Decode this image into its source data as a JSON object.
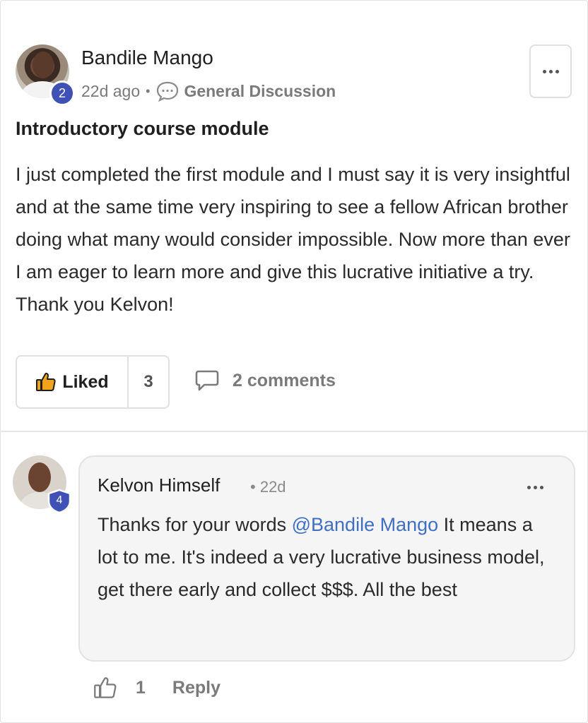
{
  "post": {
    "author": "Bandile Mango",
    "level_badge": "2",
    "time": "22d ago",
    "separator": "•",
    "category": "General Discussion",
    "title": "Introductory course module",
    "body": "I just completed the first module and I must say it is very insightful and at the same time very inspiring to see a fellow African brother doing what many would consider impossible. Now more than ever I am eager to learn more and give this lucrative initiative a try. Thank you Kelvon!",
    "like_label": "Liked",
    "like_count": "3",
    "comments_label": "2 comments"
  },
  "comment": {
    "author": "Kelvon Himself",
    "separator": "•",
    "time": "22d",
    "level_badge": "4",
    "text_before": "Thanks for your words ",
    "mention": "@Bandile Mango",
    "text_after": " It means a lot to me. It's indeed a very lucrative business model, get there early and collect $$$. All the best",
    "like_count": "1",
    "reply_label": "Reply"
  },
  "colors": {
    "badge_blue": "#3f51b5",
    "mention_blue": "#3f6fc4",
    "muted_text": "#7a7a7a",
    "comment_bg": "#f5f5f5"
  },
  "icons": {
    "menu": "more-dots-icon",
    "category": "speech-bubble-icon",
    "like": "thumbs-up-icon",
    "comments": "comment-icon"
  }
}
